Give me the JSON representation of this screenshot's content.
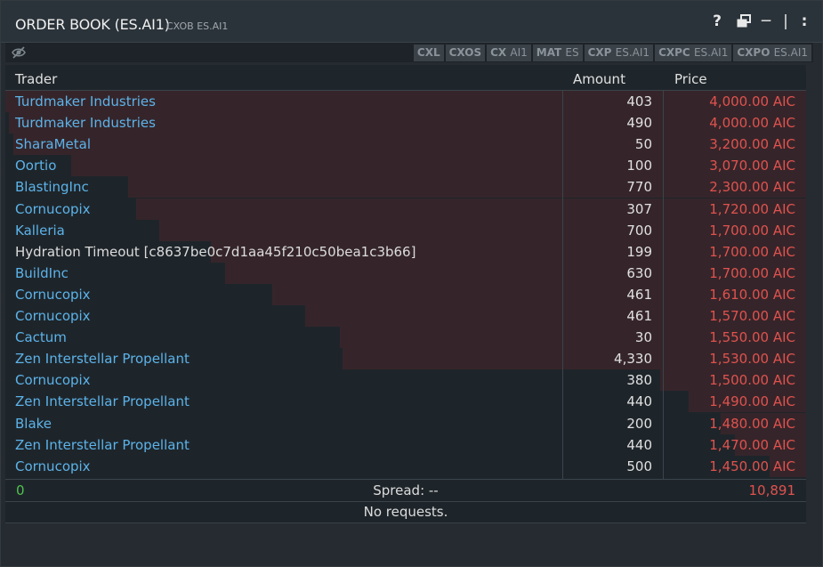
{
  "window": {
    "title": "ORDER BOOK (ES.AI1)",
    "subtitle": "CXOB ES.AI1",
    "icons": [
      "help-icon",
      "duplicate-icon",
      "minimize-icon",
      "menu-icon"
    ],
    "help_glyph": "?",
    "minimize_glyph": "─",
    "separator_glyph": "|",
    "menu_glyph": ":"
  },
  "toolbar": {
    "commands": [
      {
        "label": "CXL",
        "ticker": ""
      },
      {
        "label": "CXOS",
        "ticker": ""
      },
      {
        "label": "CX",
        "ticker": "AI1"
      },
      {
        "label": "MAT",
        "ticker": "ES"
      },
      {
        "label": "CXP",
        "ticker": "ES.AI1"
      },
      {
        "label": "CXPC",
        "ticker": "ES.AI1"
      },
      {
        "label": "CXPO",
        "ticker": "ES.AI1"
      }
    ]
  },
  "table": {
    "headers": {
      "trader": "Trader",
      "amount": "Amount",
      "price": "Price"
    },
    "rows": [
      {
        "trader": "Turdmaker Industries",
        "amount": "403",
        "price": "4,000.00 AIC",
        "link": true,
        "depth": 1.0
      },
      {
        "trader": "Turdmaker Industries",
        "amount": "490",
        "price": "4,000.00 AIC",
        "link": true,
        "depth": 0.995
      },
      {
        "trader": "SharaMetal",
        "amount": "50",
        "price": "3,200.00 AIC",
        "link": true,
        "depth": 0.99
      },
      {
        "trader": "Oortio",
        "amount": "100",
        "price": "3,070.00 AIC",
        "link": true,
        "depth": 0.918
      },
      {
        "trader": "BlastingInc",
        "amount": "770",
        "price": "2,300.00 AIC",
        "link": true,
        "depth": 0.847
      },
      {
        "trader": "Cornucopix",
        "amount": "307",
        "price": "1,720.00 AIC",
        "link": true,
        "depth": 0.837
      },
      {
        "trader": "Kalleria",
        "amount": "700",
        "price": "1,700.00 AIC",
        "link": true,
        "depth": 0.808
      },
      {
        "trader": "Hydration Timeout [c8637be0c7d1aa45f210c50bea1c3b66]",
        "amount": "199",
        "price": "1,700.00 AIC",
        "link": false,
        "depth": 0.743
      },
      {
        "trader": "BuildInc",
        "amount": "630",
        "price": "1,700.00 AIC",
        "link": true,
        "depth": 0.725
      },
      {
        "trader": "Cornucopix",
        "amount": "461",
        "price": "1,610.00 AIC",
        "link": true,
        "depth": 0.667
      },
      {
        "trader": "Cornucopix",
        "amount": "461",
        "price": "1,570.00 AIC",
        "link": true,
        "depth": 0.625
      },
      {
        "trader": "Cactum",
        "amount": "30",
        "price": "1,550.00 AIC",
        "link": true,
        "depth": 0.582
      },
      {
        "trader": "Zen Interstellar Propellant",
        "amount": "4,330",
        "price": "1,530.00 AIC",
        "link": true,
        "depth": 0.579
      },
      {
        "trader": "Cornucopix",
        "amount": "380",
        "price": "1,500.00 AIC",
        "link": true,
        "depth": 0.182
      },
      {
        "trader": "Zen Interstellar Propellant",
        "amount": "440",
        "price": "1,490.00 AIC",
        "link": true,
        "depth": 0.147
      },
      {
        "trader": "Blake",
        "amount": "200",
        "price": "1,480.00 AIC",
        "link": true,
        "depth": 0.107
      },
      {
        "trader": "Zen Interstellar Propellant",
        "amount": "440",
        "price": "1,470.00 AIC",
        "link": true,
        "depth": 0.089
      },
      {
        "trader": "Cornucopix",
        "amount": "500",
        "price": "1,450.00 AIC",
        "link": true,
        "depth": 0.046
      }
    ]
  },
  "spread": {
    "left": "0",
    "label": "Spread: --",
    "right": "10,891"
  },
  "requests": {
    "empty_text": "No requests."
  },
  "colors": {
    "link": "#5cb3ea",
    "ask_price": "#e0524e",
    "bid_total": "#4fc24f",
    "depth_bar": "#3a262a"
  }
}
